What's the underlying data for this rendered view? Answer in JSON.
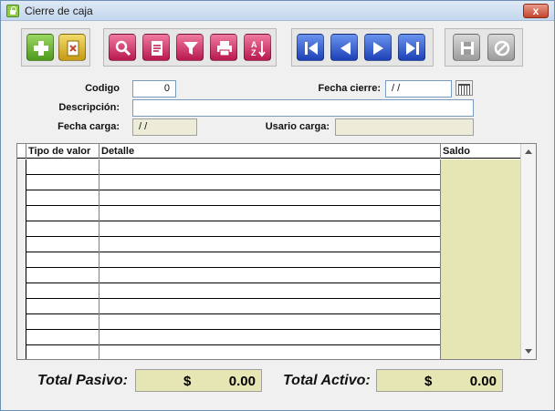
{
  "window": {
    "title": "Cierre de caja",
    "close_label": "x"
  },
  "toolbar": {
    "groups": [
      {
        "buttons": [
          {
            "icon": "add-icon",
            "color": "#4d9a1d"
          },
          {
            "icon": "delete-icon",
            "color": "#c69a14"
          }
        ]
      },
      {
        "buttons": [
          {
            "icon": "search-icon",
            "color": "#b8184e"
          },
          {
            "icon": "edit-icon",
            "color": "#b8184e"
          },
          {
            "icon": "filter-icon",
            "color": "#b8184e"
          },
          {
            "icon": "print-icon",
            "color": "#b8184e"
          },
          {
            "icon": "sort-icon",
            "color": "#b8184e"
          }
        ]
      },
      {
        "buttons": [
          {
            "icon": "first-icon",
            "color": "#1d41b6"
          },
          {
            "icon": "previous-icon",
            "color": "#1d41b6"
          },
          {
            "icon": "next-icon",
            "color": "#1d41b6"
          },
          {
            "icon": "last-icon",
            "color": "#1d41b6"
          }
        ]
      },
      {
        "buttons": [
          {
            "icon": "save-icon",
            "color": "#9c9c9c"
          },
          {
            "icon": "cancel-icon",
            "color": "#9c9c9c"
          }
        ]
      }
    ]
  },
  "form": {
    "codigo_label": "Codigo",
    "codigo_value": "0",
    "fecha_cierre_label": "Fecha cierre:",
    "fecha_cierre_value": "/ /",
    "descripcion_label": "Descripción:",
    "descripcion_value": "",
    "fecha_carga_label": "Fecha carga:",
    "fecha_carga_value": "/ /",
    "usuario_carga_label": "Usario carga:",
    "usuario_carga_value": ""
  },
  "grid": {
    "columns": [
      "Tipo de valor",
      "Detalle",
      "Saldo"
    ],
    "rows": [
      [
        "",
        "",
        ""
      ],
      [
        "",
        "",
        ""
      ],
      [
        "",
        "",
        ""
      ],
      [
        "",
        "",
        ""
      ],
      [
        "",
        "",
        ""
      ],
      [
        "",
        "",
        ""
      ],
      [
        "",
        "",
        ""
      ],
      [
        "",
        "",
        ""
      ],
      [
        "",
        "",
        ""
      ],
      [
        "",
        "",
        ""
      ],
      [
        "",
        "",
        ""
      ],
      [
        "",
        "",
        ""
      ],
      [
        "",
        "",
        ""
      ]
    ]
  },
  "totals": {
    "pasivo_label": "Total Pasivo:",
    "pasivo_currency": "$",
    "pasivo_value": "0.00",
    "activo_label": "Total Activo:",
    "activo_currency": "$",
    "activo_value": "0.00"
  },
  "colors": {
    "readonly_fill": "#ececd9",
    "saldo_fill": "#e6e6b4"
  }
}
